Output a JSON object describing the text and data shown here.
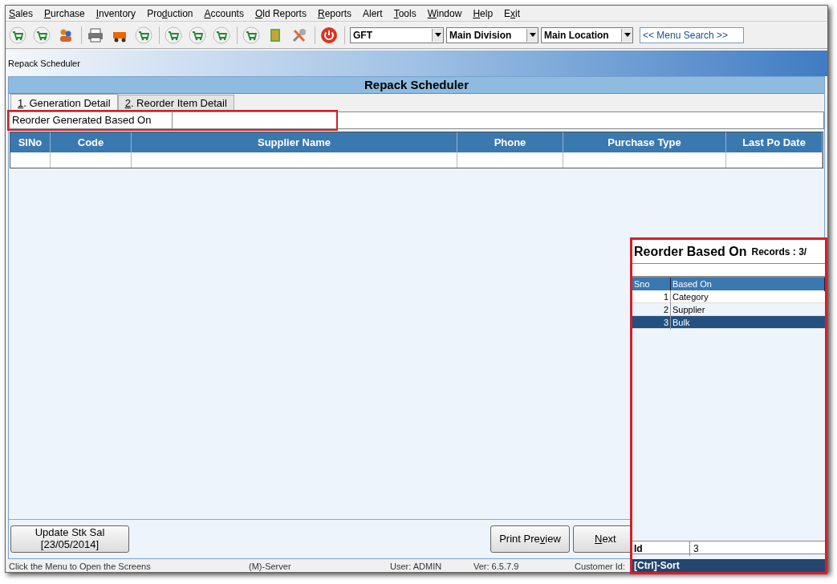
{
  "menu": [
    {
      "key": "S",
      "post": "ales"
    },
    {
      "key": "P",
      "post": "urchase"
    },
    {
      "key": "I",
      "post": "nventory"
    },
    {
      "pre": "Pro",
      "key": "d",
      "post": "uction"
    },
    {
      "key": "A",
      "post": "ccounts"
    },
    {
      "key": "O",
      "post": "ld Reports"
    },
    {
      "key": "R",
      "post": "eports"
    },
    {
      "pre": "Alert"
    },
    {
      "key": "T",
      "post": "ools"
    },
    {
      "key": "W",
      "post": "indow"
    },
    {
      "key": "H",
      "post": "elp"
    },
    {
      "pre": "E",
      "key": "x",
      "post": "it"
    }
  ],
  "toolbar": {
    "selects": [
      {
        "value": "GFT"
      },
      {
        "value": "Main Division"
      },
      {
        "value": "Main Location"
      }
    ],
    "search": {
      "value": "<< Menu Search >>"
    }
  },
  "window": {
    "title": "Repack Scheduler",
    "header": "Repack Scheduler"
  },
  "tabs": [
    {
      "key": "1",
      "post": ". Generation Detail",
      "selected": true
    },
    {
      "key": "2",
      "post": ". Reorder Item Detail",
      "selected": false
    }
  ],
  "field": {
    "label": "Reorder Generated Based On",
    "highlighted": true
  },
  "table": {
    "columns": [
      "SlNo",
      "Code",
      "Supplier Name",
      "Phone",
      "Purchase Type",
      "Last Po Date"
    ]
  },
  "buttons": {
    "update": {
      "line1": "Update Stk Sal",
      "line2": "[23/05/2014]"
    },
    "preview": {
      "pre": "Print Pre",
      "key": "v",
      "post": "iew"
    },
    "next": {
      "key": "N",
      "post": "ext"
    }
  },
  "status_bar": [
    "Click the Menu to Open the Screens",
    "(M)-Server",
    "User: ADMIN",
    "Ver: 6.5.7.9",
    "Customer Id:"
  ],
  "popup": {
    "title": "Reorder Based On",
    "records": "Records : 3/",
    "highlighted": true,
    "columns": [
      "Sno",
      "Based On"
    ],
    "rows": [
      {
        "sno": "1",
        "name": "Category",
        "selected": false
      },
      {
        "sno": "2",
        "name": "Supplier",
        "selected": false
      },
      {
        "sno": "3",
        "name": "Bulk",
        "selected": true
      }
    ],
    "footer_label": "Id",
    "footer_value": "3",
    "hint": "[Ctrl]-Sort"
  }
}
